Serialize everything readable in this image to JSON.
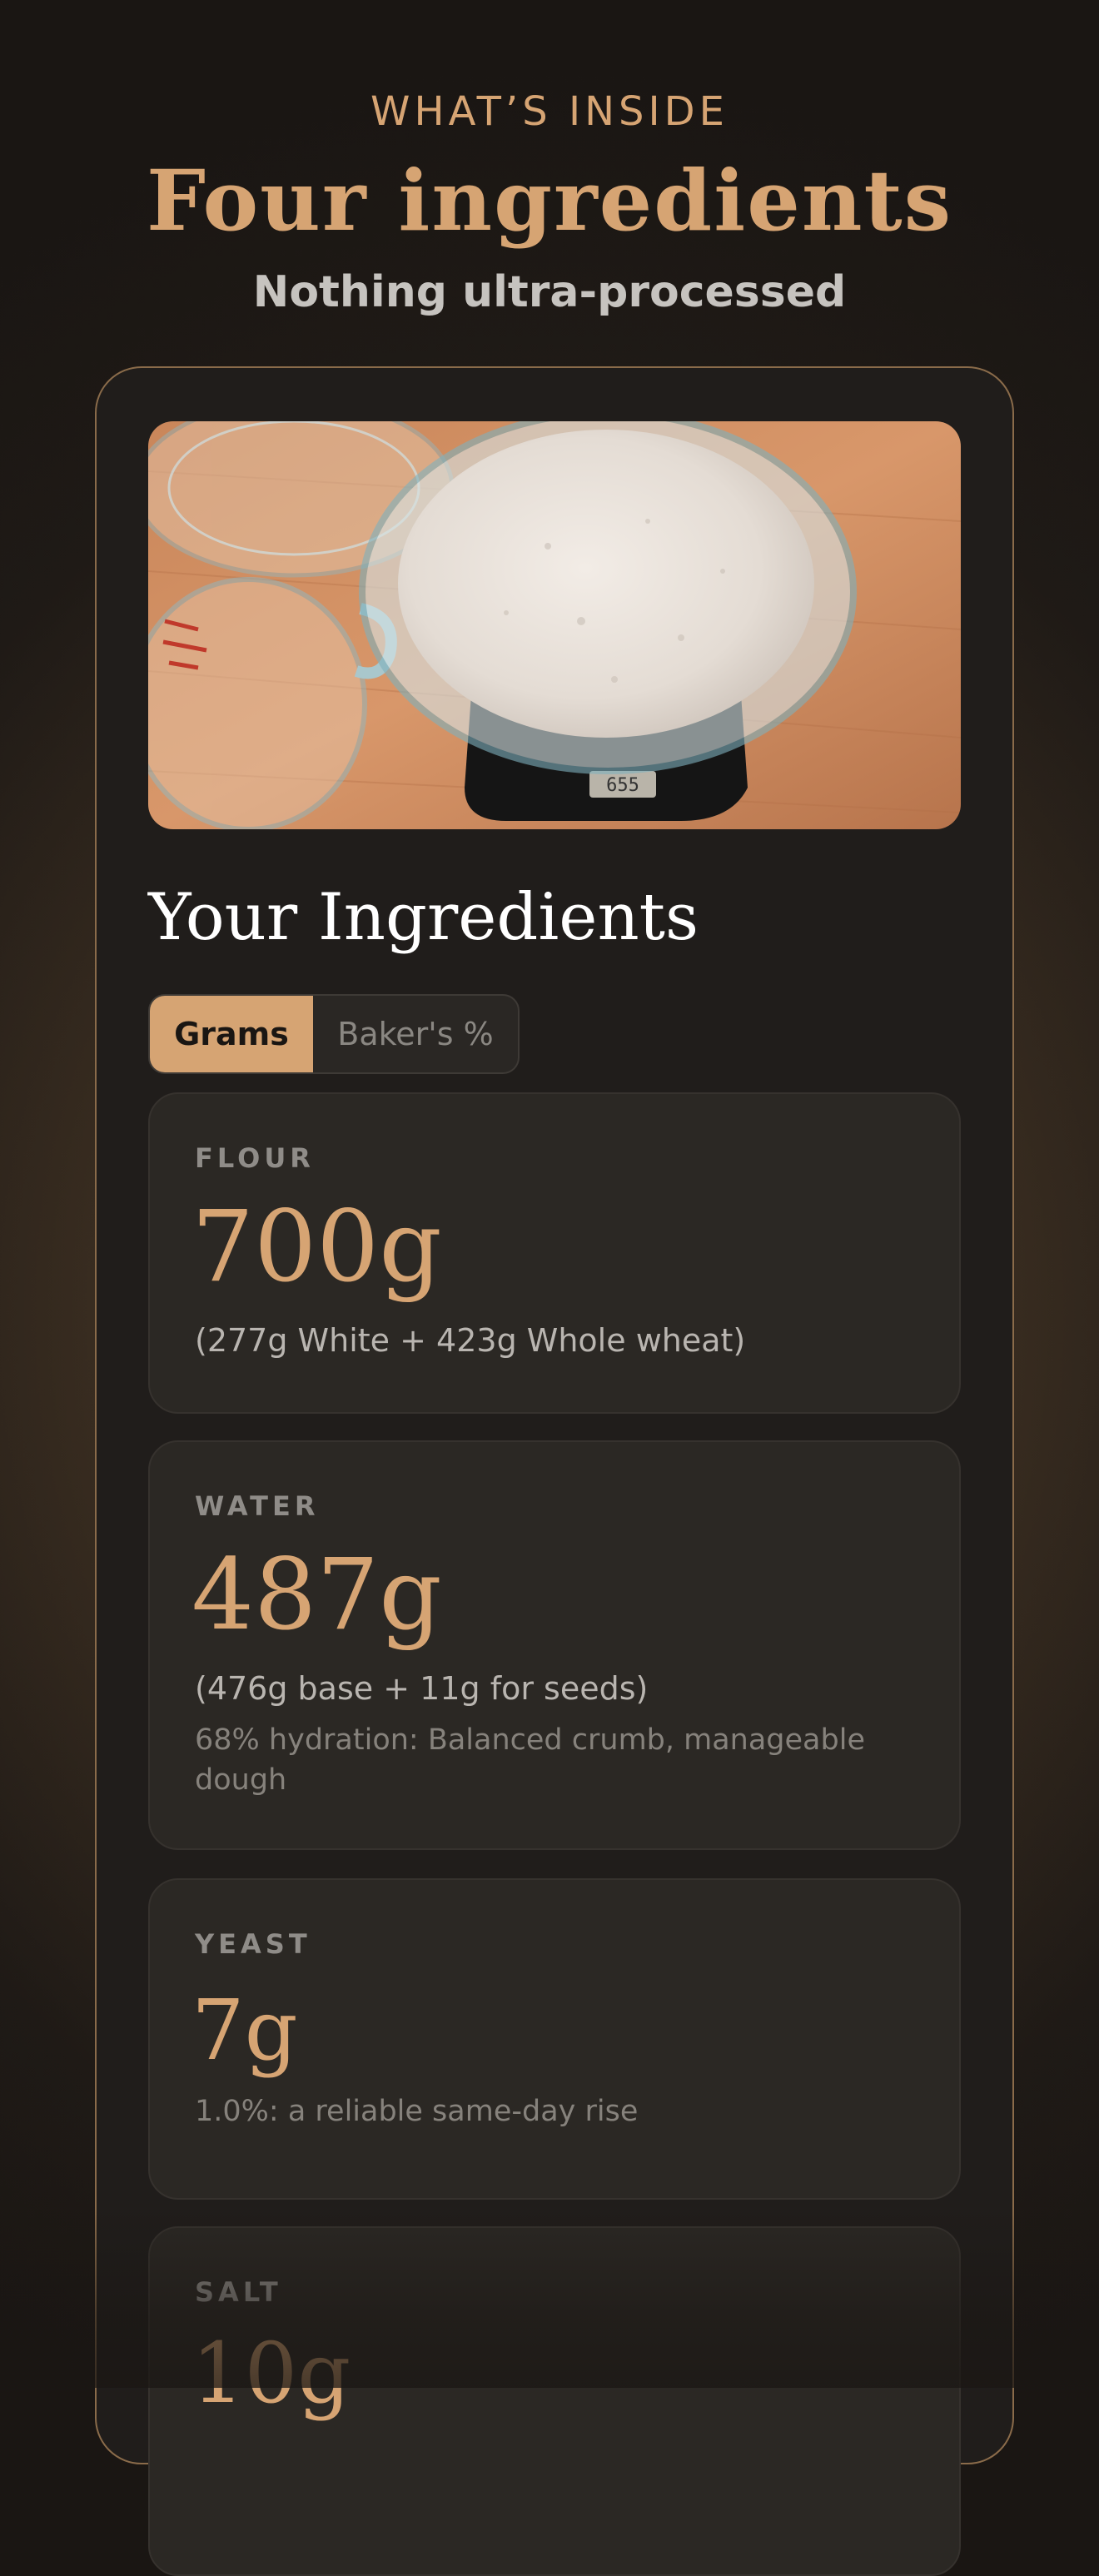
{
  "header": {
    "eyebrow": "WHAT’S INSIDE",
    "title": "Four ingredients",
    "subtitle": "Nothing ultra-processed"
  },
  "photo": {
    "scale_display": "655"
  },
  "ingredients_section": {
    "title": "Your Ingredients",
    "toggle": {
      "options": [
        "Grams",
        "Baker's %"
      ],
      "selected": "Grams"
    },
    "items": [
      {
        "label": "FLOUR",
        "value": "700g",
        "detail": "(277g White + 423g Whole wheat)",
        "note": ""
      },
      {
        "label": "WATER",
        "value": "487g",
        "detail": "(476g base + 11g for seeds)",
        "note": "68% hydration: Balanced crumb, manageable dough"
      },
      {
        "label": "YEAST",
        "value": "7g",
        "detail": "",
        "note": "1.0%: a reliable same-day rise"
      },
      {
        "label": "SALT",
        "value": "10g",
        "detail": "",
        "note": ""
      }
    ]
  },
  "colors": {
    "accent": "#d6a473",
    "card_bg": "#201d1b",
    "item_bg": "#2b2824",
    "text_primary": "#ffffff",
    "text_muted": "#8f8c88"
  }
}
